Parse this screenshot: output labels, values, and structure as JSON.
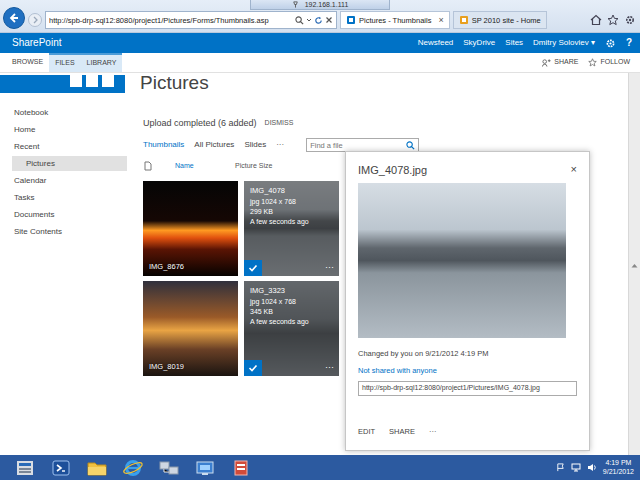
{
  "remote_bar": {
    "title": "192.168.1.111"
  },
  "browser": {
    "address": "http://spb-drp-sql12:8080/project1/Pictures/Forms/Thumbnails.asp",
    "tabs": [
      {
        "label": "Pictures - Thumbnails",
        "selected": true
      },
      {
        "label": "SP 2010 site - Home",
        "selected": false
      }
    ],
    "tab_close": "×"
  },
  "suite_bar": {
    "brand": "SharePoint",
    "links": [
      "Newsfeed",
      "SkyDrive",
      "Sites"
    ],
    "user": "Dmitry Soloviev ▾",
    "help": "?"
  },
  "ribbon": {
    "tabs": [
      {
        "label": "BROWSE",
        "kind": "plain"
      },
      {
        "label": "FILES",
        "kind": "contextual"
      },
      {
        "label": "LIBRARY",
        "kind": "contextual"
      }
    ],
    "actions": [
      "SHARE",
      "FOLLOW"
    ]
  },
  "page_title": "Pictures",
  "sidebar": {
    "items": [
      {
        "label": "Notebook",
        "kind": "top",
        "selected": false
      },
      {
        "label": "Home",
        "kind": "top",
        "selected": false
      },
      {
        "label": "Recent",
        "kind": "top",
        "selected": false
      },
      {
        "label": "Pictures",
        "kind": "sub",
        "selected": true
      },
      {
        "label": "Calendar",
        "kind": "top",
        "selected": false
      },
      {
        "label": "Tasks",
        "kind": "top",
        "selected": false
      },
      {
        "label": "Documents",
        "kind": "top",
        "selected": false
      },
      {
        "label": "Site Contents",
        "kind": "top",
        "selected": false
      }
    ]
  },
  "notice": {
    "text": "Upload completed (6 added)",
    "action": "DISMISS"
  },
  "views": {
    "items": [
      {
        "label": "Thumbnails",
        "selected": true
      },
      {
        "label": "All Pictures",
        "selected": false
      },
      {
        "label": "Slides",
        "selected": false
      }
    ],
    "more": "···"
  },
  "search": {
    "placeholder": "Find a file"
  },
  "columns": [
    "Name",
    "Picture Size"
  ],
  "thumbnails": [
    {
      "name": "IMG_8676",
      "selected": false
    },
    {
      "name": "IMG_4078",
      "selected": true,
      "details": [
        "jpg 1024 x 768",
        "299 KB",
        "A few seconds ago"
      ],
      "more": "···"
    },
    {
      "name": "IMG_8019",
      "selected": false
    },
    {
      "name": "IMG_3323",
      "selected": true,
      "details": [
        "jpg 1024 x 768",
        "345 KB",
        "A few seconds ago"
      ],
      "more": "···"
    }
  ],
  "callout": {
    "title": "IMG_4078.jpg",
    "close": "×",
    "changed": "Changed by you on 9/21/2012 4:19 PM",
    "sharing": "Not shared with anyone",
    "url": "http://spb-drp-sql12:8080/project1/Pictures/IMG_4078.jpg",
    "actions": [
      "EDIT",
      "SHARE"
    ],
    "more": "···"
  },
  "taskbar": {
    "time": "4:19 PM",
    "date": "9/21/2012"
  }
}
